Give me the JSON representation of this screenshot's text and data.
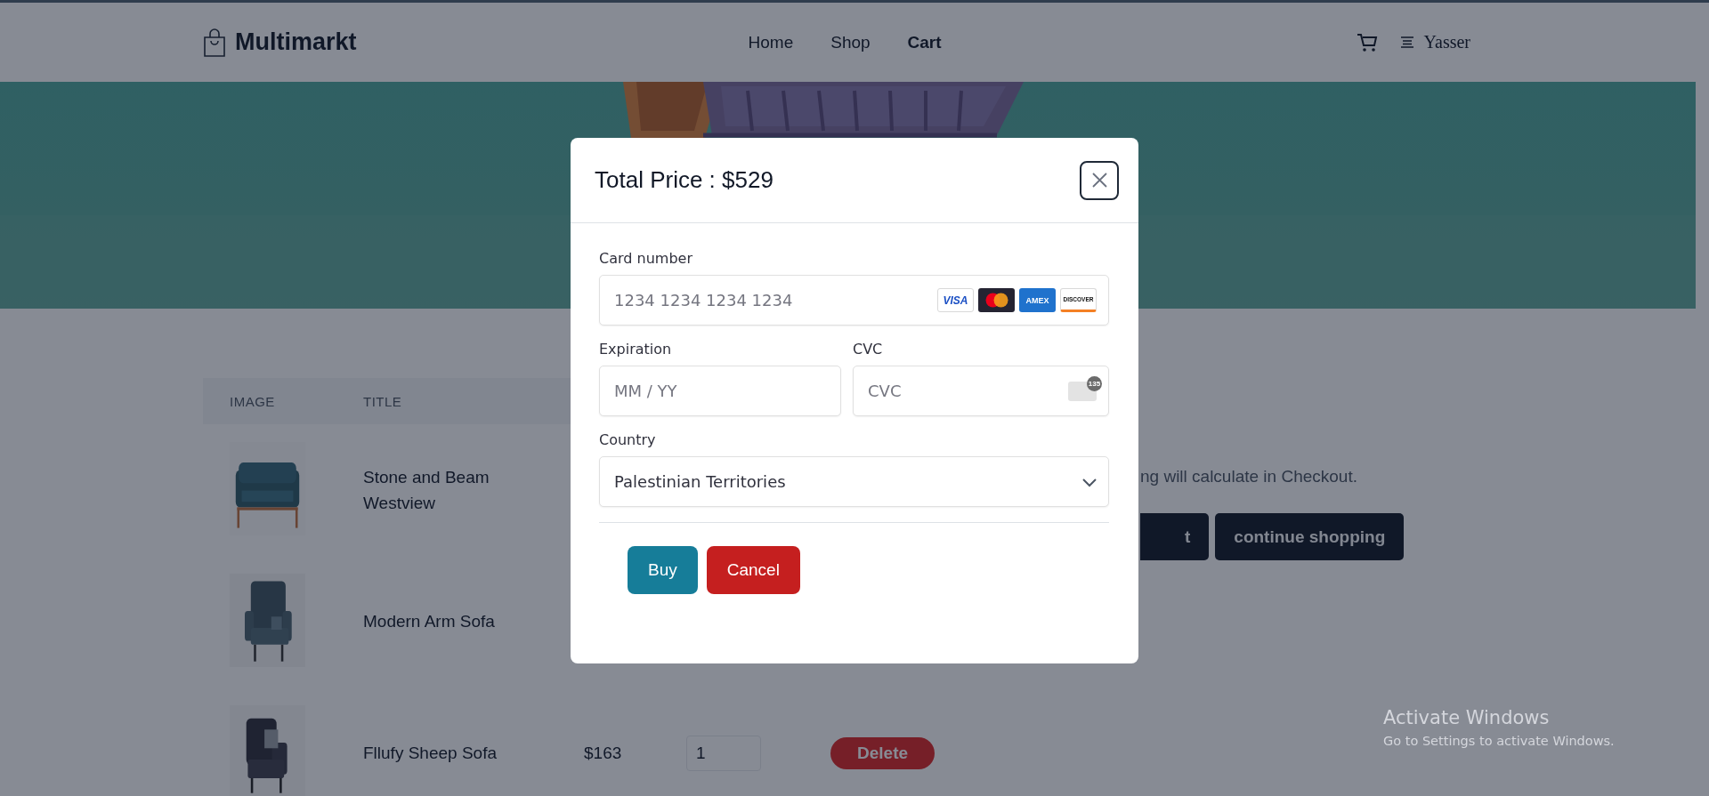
{
  "header": {
    "logo": "Multimarkt",
    "nav": [
      {
        "label": "Home",
        "selected": false
      },
      {
        "label": "Shop",
        "selected": false
      },
      {
        "label": "Cart",
        "selected": true
      }
    ],
    "user": "Yasser"
  },
  "cart_table": {
    "columns": [
      "IMAGE",
      "TITLE"
    ],
    "rows": [
      {
        "title": "Stone and Beam Westview"
      },
      {
        "title": "Modern Arm Sofa"
      },
      {
        "title": "Fllufy Sheep Sofa",
        "price": "$163",
        "quantity": "1",
        "action": "Delete"
      }
    ]
  },
  "summary": {
    "note": "ng will calculate in Checkout.",
    "buttons": [
      "t",
      "continue shopping"
    ]
  },
  "modal": {
    "title": "Total Price : $529",
    "card_number": {
      "label": "Card number",
      "placeholder": "1234 1234 1234 1234",
      "brands": [
        {
          "kind": "visa",
          "text": "VISA"
        },
        {
          "kind": "mastercard"
        },
        {
          "kind": "amex",
          "text": "AMEX"
        },
        {
          "kind": "discover",
          "text": "DISCOVER"
        }
      ]
    },
    "expiration": {
      "label": "Expiration",
      "placeholder": "MM / YY"
    },
    "cvc": {
      "label": "CVC",
      "placeholder": "CVC",
      "badge": "135"
    },
    "country": {
      "label": "Country",
      "value": "Palestinian Territories"
    },
    "buttons": [
      {
        "label": "Buy",
        "kind": "primary"
      },
      {
        "label": "Cancel",
        "kind": "danger"
      }
    ]
  },
  "os_notice": {
    "title": "Activate Windows",
    "text": "Go to Settings to activate Windows."
  }
}
